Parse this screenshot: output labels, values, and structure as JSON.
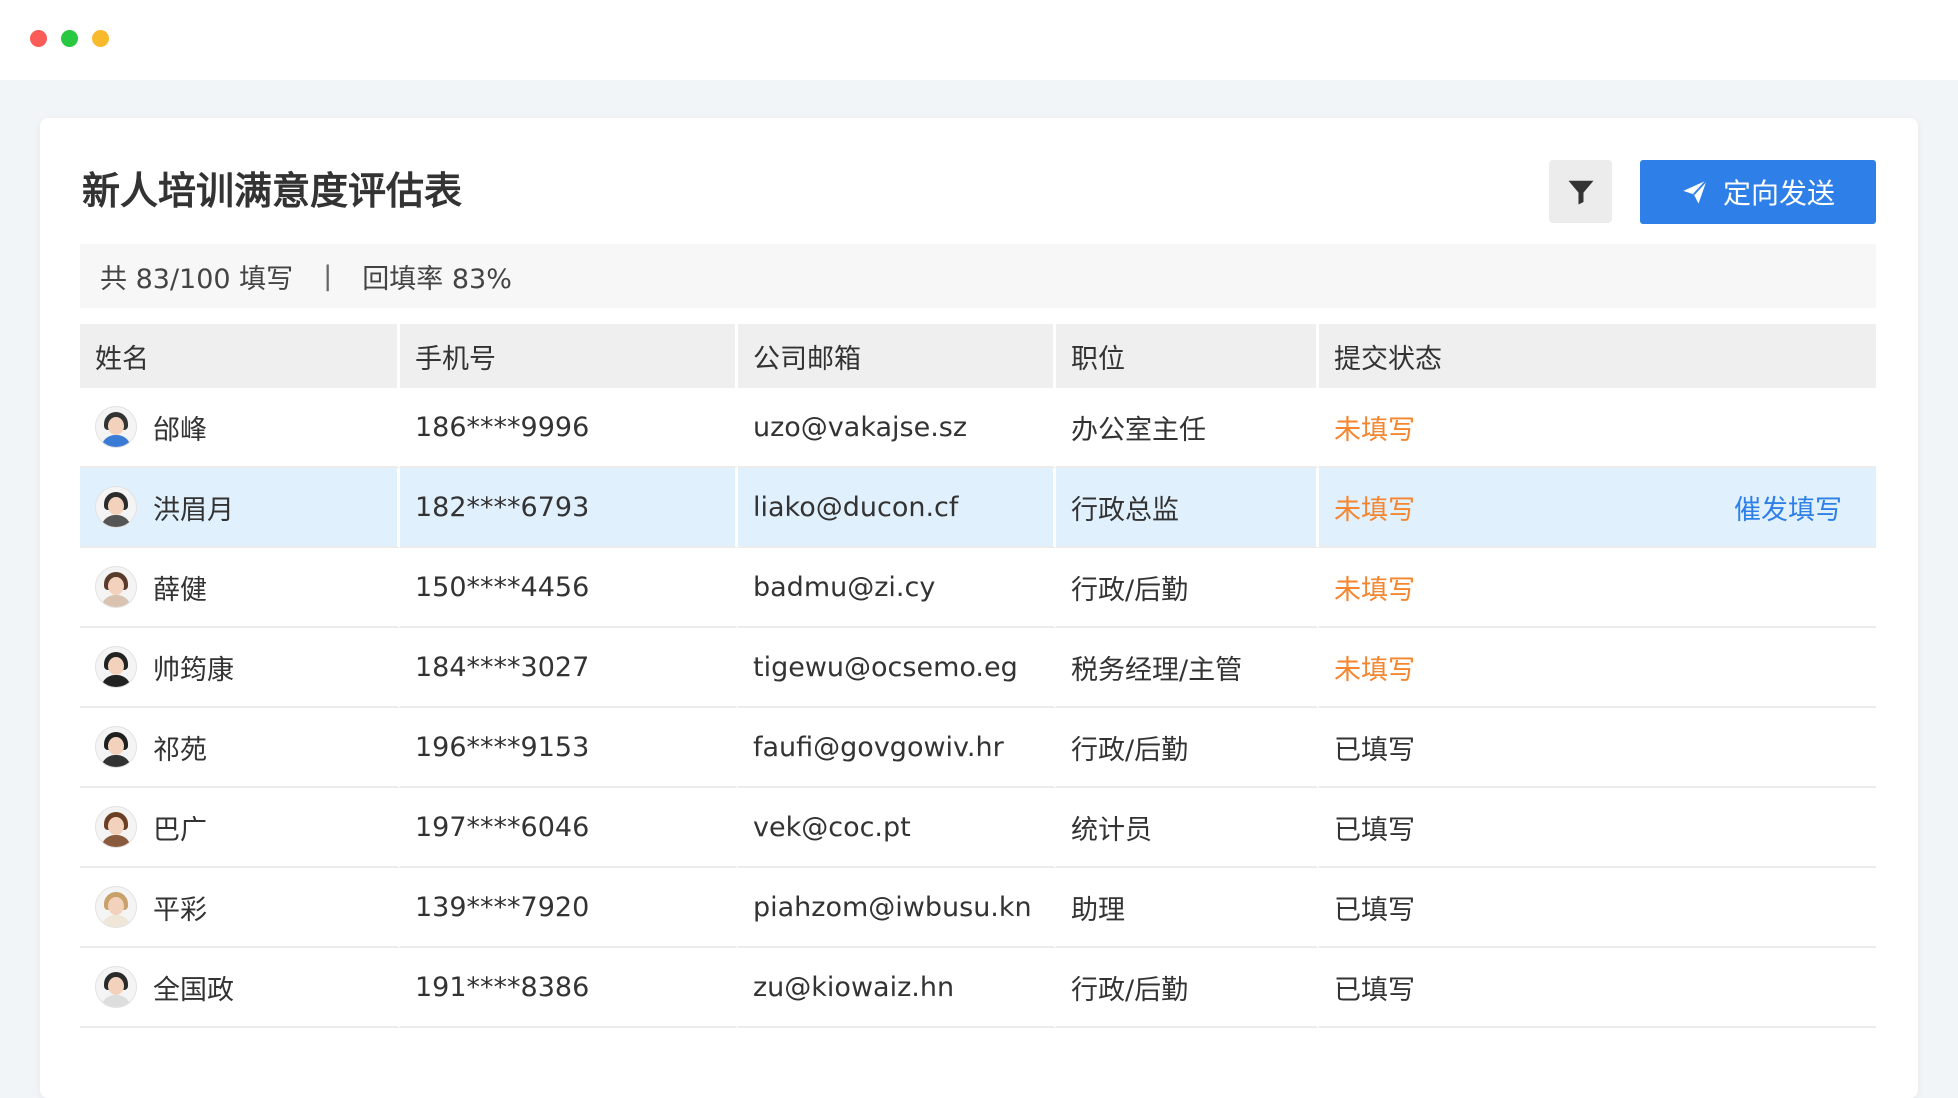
{
  "window": {
    "controls": [
      "close",
      "maximize",
      "minimize"
    ]
  },
  "page": {
    "title": "新人培训满意度评估表",
    "filter_icon": "filter-icon",
    "send_button": {
      "icon": "paper-plane-icon",
      "label": "定向发送"
    },
    "summary": {
      "total": "共 83/100 填写",
      "separator": "|",
      "rate": "回填率 83%"
    }
  },
  "colors": {
    "accent": "#2f7fe8",
    "pending": "#f5862f",
    "highlight_row": "#e0f0fd"
  },
  "table": {
    "headers": [
      "姓名",
      "手机号",
      "公司邮箱",
      "职位",
      "提交状态"
    ],
    "rows": [
      {
        "name": "邰峰",
        "phone": "186****9996",
        "email": "uzo@vakajse.sz",
        "title": "办公室主任",
        "status": "未填写",
        "action": "",
        "highlighted": false,
        "avatar": {
          "hair": "#333333",
          "body": "#3a7bd5"
        }
      },
      {
        "name": "洪眉月",
        "phone": "182****6793",
        "email": "liako@ducon.cf",
        "title": "行政总监",
        "status": "未填写",
        "action": "催发填写",
        "highlighted": true,
        "avatar": {
          "hair": "#2b2b2b",
          "body": "#555555"
        }
      },
      {
        "name": "薛健",
        "phone": "150****4456",
        "email": "badmu@zi.cy",
        "title": "行政/后勤",
        "status": "未填写",
        "action": "",
        "highlighted": false,
        "avatar": {
          "hair": "#5a3a2a",
          "body": "#d9c3b0"
        }
      },
      {
        "name": "帅筠康",
        "phone": "184****3027",
        "email": "tigewu@ocsemo.eg",
        "title": "税务经理/主管",
        "status": "未填写",
        "action": "",
        "highlighted": false,
        "avatar": {
          "hair": "#222222",
          "body": "#222222"
        }
      },
      {
        "name": "祁苑",
        "phone": "196****9153",
        "email": "faufi@govgowiv.hr",
        "title": "行政/后勤",
        "status": "已填写",
        "action": "",
        "highlighted": false,
        "avatar": {
          "hair": "#1f1f1f",
          "body": "#333333"
        }
      },
      {
        "name": "巴广",
        "phone": "197****6046",
        "email": "vek@coc.pt",
        "title": "统计员",
        "status": "已填写",
        "action": "",
        "highlighted": false,
        "avatar": {
          "hair": "#6b3f24",
          "body": "#8a5a3c"
        }
      },
      {
        "name": "平彩",
        "phone": "139****7920",
        "email": "piahzom@iwbusu.kn",
        "title": "助理",
        "status": "已填写",
        "action": "",
        "highlighted": false,
        "avatar": {
          "hair": "#c8a06a",
          "body": "#efe6d8"
        }
      },
      {
        "name": "全国政",
        "phone": "191****8386",
        "email": "zu@kiowaiz.hn",
        "title": "行政/后勤",
        "status": "已填写",
        "action": "",
        "highlighted": false,
        "avatar": {
          "hair": "#2a2a2a",
          "body": "#dddddd"
        }
      }
    ]
  }
}
